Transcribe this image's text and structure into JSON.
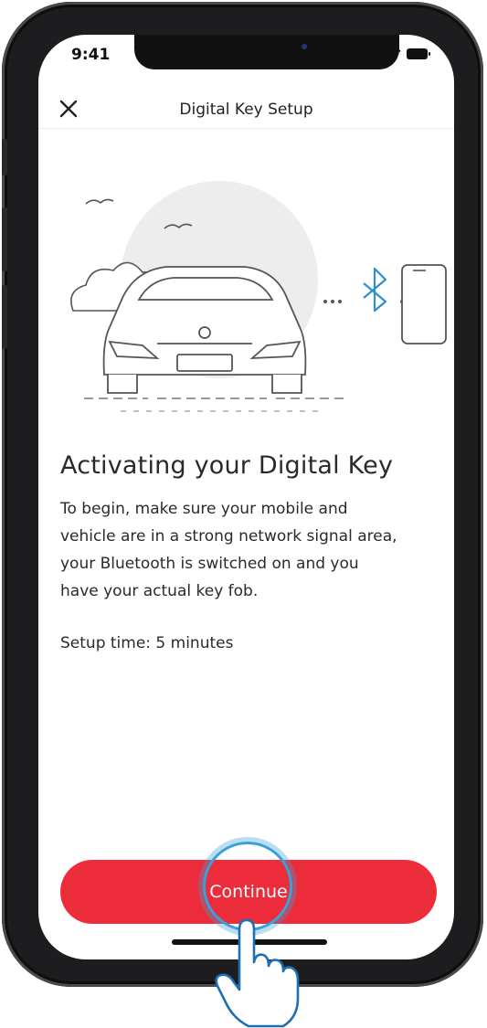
{
  "status_bar": {
    "time": "9:41"
  },
  "header": {
    "title": "Digital Key Setup",
    "close_icon": "close-icon"
  },
  "content": {
    "heading": "Activating your Digital Key",
    "description_lines": [
      "To begin, make sure your mobile and",
      "vehicle are in a strong network signal area,",
      "your Bluetooth is switched on and you",
      "have your actual key fob."
    ],
    "setup_time": "Setup time: 5 minutes"
  },
  "actions": {
    "continue_label": "Continue"
  },
  "colors": {
    "accent": "#ec2b3b",
    "bluetooth": "#2f8fd0",
    "touch_ring": "#3aa0d8"
  }
}
